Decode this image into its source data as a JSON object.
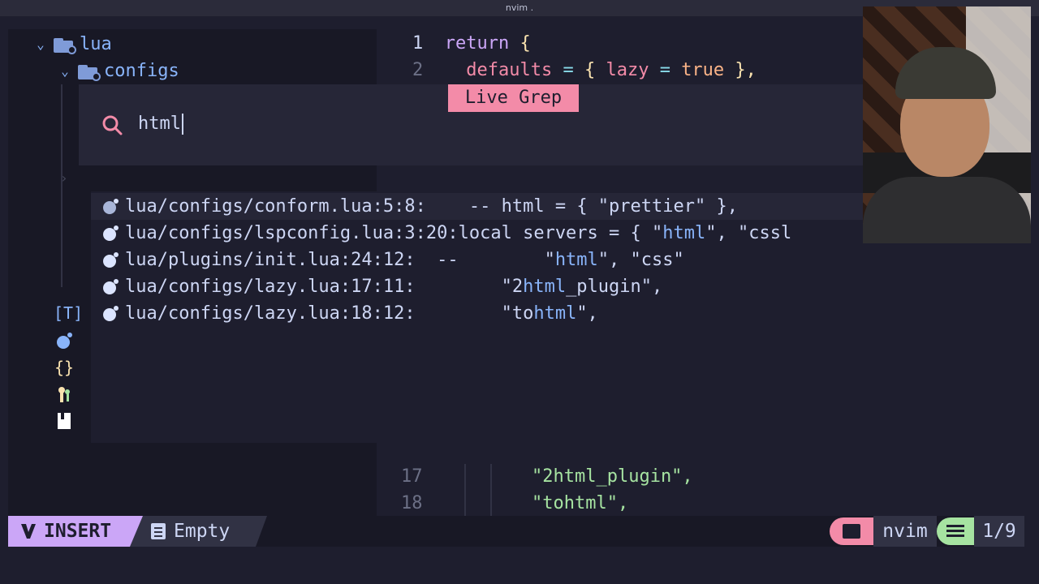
{
  "window": {
    "title": "nvim ."
  },
  "tree": {
    "items": [
      {
        "label": "lua",
        "expanded": true
      },
      {
        "label": "configs",
        "expanded": true
      }
    ],
    "side_icons": [
      "tag-icon",
      "bomb-icon",
      "braces-icon",
      "keys-icon",
      "bookmark-icon"
    ],
    "tag_label": "[T]",
    "braces_label": "{}"
  },
  "editor": {
    "lines": [
      {
        "num": "1",
        "tokens": [
          "return",
          "{"
        ]
      },
      {
        "num": "2",
        "tokens": [
          "defaults",
          "=",
          "{",
          "lazy",
          "=",
          "true",
          "},"
        ]
      }
    ]
  },
  "telescope": {
    "title": "Live Grep",
    "query": "html",
    "results": [
      {
        "path": "lua/configs/conform.lua:5:8:",
        "before": "    -- ",
        "match": "html",
        "after": " = { \"prettier\" },",
        "selected": true
      },
      {
        "path": "lua/configs/lspconfig.lua:3:20:",
        "before": "local servers = { \"",
        "match": "html",
        "after": "\", \"cssl",
        "selected": false
      },
      {
        "path": "lua/plugins/init.lua:24:12:",
        "before": "  --        \"",
        "match": "html",
        "after": "\", \"css\"",
        "selected": false
      },
      {
        "path": "lua/configs/lazy.lua:17:11:",
        "before": "        \"2",
        "match": "html",
        "after": "_plugin\",",
        "selected": false
      },
      {
        "path": "lua/configs/lazy.lua:18:12:",
        "before": "        \"to",
        "match": "html",
        "after": "\",",
        "selected": false
      }
    ]
  },
  "preview": {
    "lines": [
      {
        "num": "17",
        "text": "\"2html_plugin\","
      },
      {
        "num": "18",
        "text": "\"tohtml\","
      }
    ]
  },
  "statusbar": {
    "mode": "INSERT",
    "buffer": "Empty",
    "cwd": "nvim",
    "position": "1/9"
  },
  "colors": {
    "mode": "#cba6f7",
    "accent_pink": "#f38ba8",
    "accent_green": "#a6e3a1",
    "match_blue": "#89b4fa"
  }
}
